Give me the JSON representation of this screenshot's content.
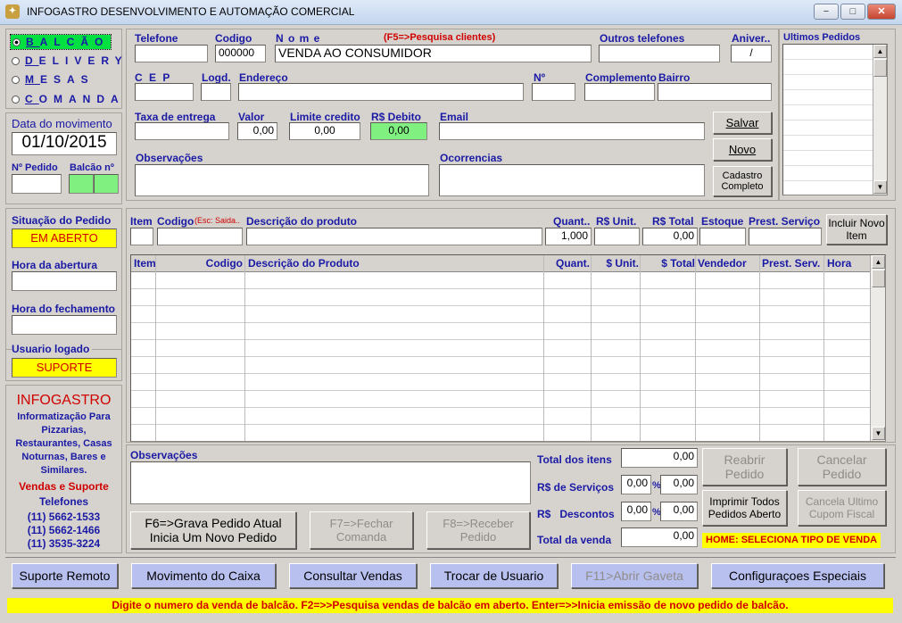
{
  "window": {
    "title": "INFOGASTRO DESENVOLVIMENTO E AUTOMAÇÃO COMERCIAL",
    "icon": "app-icon",
    "minimize": "−",
    "maximize": "□",
    "close": "✕"
  },
  "sale_types": [
    {
      "label": "BALCÃO",
      "hotkey": "B",
      "selected": true
    },
    {
      "label": "DELIVERY",
      "hotkey": "D",
      "selected": false
    },
    {
      "label": "MESAS",
      "hotkey": "M",
      "selected": false
    },
    {
      "label": "COMANDA",
      "hotkey": "C",
      "selected": false
    }
  ],
  "movement": {
    "label": "Data do movimento",
    "date": "01/10/2015"
  },
  "order": {
    "number_label": "Nº Pedido",
    "counter_label": "Balcão nº",
    "status_label": "Situação do Pedido",
    "status": "EM ABERTO",
    "open_time_label": "Hora da abertura",
    "close_time_label": "Hora do fechamento",
    "user_label": "Usuario logado",
    "user": "SUPORTE"
  },
  "branding": {
    "name": "INFOGASTRO",
    "tagline": "Informatização Para Pizzarias, Restaurantes, Casas Noturnas, Bares e Similares.",
    "sales_label": "Vendas e Suporte",
    "phones_label": "Telefones",
    "phones": [
      "(11) 5662-1533",
      "(11) 5662-1466",
      "(11) 3535-3224"
    ]
  },
  "customer": {
    "phone_label": "Telefone",
    "code_label": "Codigo",
    "code": "000000",
    "name_label": "N o m e",
    "name_hint": "(F5=>Pesquisa clientes)",
    "name": "VENDA AO CONSUMIDOR",
    "other_phones_label": "Outros telefones",
    "birthday_label": "Aniver..",
    "birthday": "/",
    "cep_label": "C E P",
    "logd_label": "Logd.",
    "address_label": "Endereço",
    "number_label": "Nº",
    "complement_label": "Complemento",
    "district_label": "Bairro",
    "delivery_fee_label": "Taxa de entrega",
    "value_label": "Valor",
    "value": "0,00",
    "credit_label": "Limite credito",
    "credit": "0,00",
    "debit_label": "R$ Debito",
    "debit": "0,00",
    "email_label": "Email",
    "notes_label": "Observações",
    "occurrences_label": "Ocorrencias"
  },
  "customer_buttons": {
    "save": "Salvar",
    "new": "Novo",
    "full_register": "Cadastro Completo"
  },
  "last_orders": {
    "label": "Ultimos Pedidos"
  },
  "item_entry": {
    "item_label": "Item",
    "code_label": "Codigo",
    "code_hint": "(Esc: Saida..",
    "desc_label": "Descrição do produto",
    "qty_label": "Quant..",
    "unit_label": "R$ Unit.",
    "total_label": "R$ Total",
    "stock_label": "Estoque",
    "service_label": "Prest. Serviço",
    "qty": "1,000",
    "total": "0,00",
    "add_button": "Incluir Novo Item"
  },
  "grid": {
    "columns": [
      "Item",
      "Codigo",
      "Descrição do Produto",
      "Quant.",
      "$ Unit.",
      "$ Total",
      "Vendedor",
      "Prest. Serv.",
      "Hora"
    ],
    "rows": []
  },
  "notes": {
    "label": "Observações"
  },
  "totals": {
    "items_label": "Total  dos itens",
    "items": "0,00",
    "services_label": "R$ de Serviços",
    "services_pct": "0,00",
    "services": "0,00",
    "discount_label": "R$   Descontos",
    "discount_pct": "0,00",
    "discount": "0,00",
    "sale_label": "Total da venda",
    "sale": "0,00",
    "pct": "%"
  },
  "actions": {
    "save_order": "F6=>Grava Pedido Atual Inicia Um Novo Pedido",
    "close_tab": "F7=>Fechar Comanda",
    "receive": "F8=>Receber Pedido",
    "reopen": "Reabrir Pedido",
    "cancel": "Cancelar Pedido",
    "print_all": "Imprimir Todos Pedidos Aberto",
    "cancel_coupon": "Cancela Ultimo Cupom Fiscal"
  },
  "home_hint": "HOME: SELECIONA TIPO DE VENDA",
  "toolbar": {
    "remote": "Suporte Remoto",
    "cash": "Movimento do Caixa",
    "sales": "Consultar Vendas",
    "switch_user": "Trocar de Usuario",
    "drawer": "F11>Abrir Gaveta",
    "settings": "Configuraçoes Especiais"
  },
  "status": "Digite o numero da venda de balcão.  F2=>>Pesquisa vendas de balcão em aberto.  Enter=>>Inicia emissão de novo pedido de balcão."
}
